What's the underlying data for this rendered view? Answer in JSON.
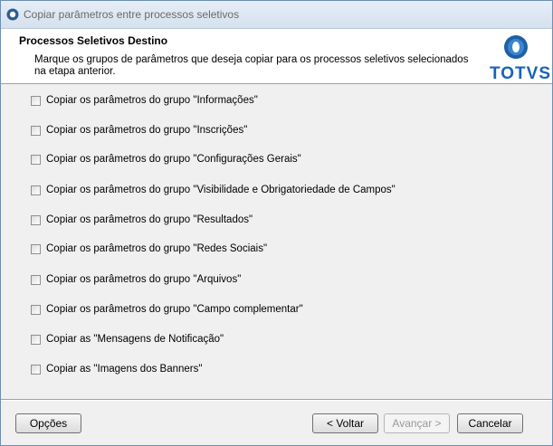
{
  "window": {
    "title": "Copiar parâmetros entre processos seletivos"
  },
  "header": {
    "title": "Processos Seletivos Destino",
    "description": "Marque os grupos de parâmetros que deseja copiar para os processos seletivos selecionados na etapa anterior.",
    "logo_text": "TOTVS",
    "logo_color": "#1b63b6"
  },
  "options": [
    {
      "label": "Copiar os parâmetros do grupo \"Informações\"",
      "checked": false
    },
    {
      "label": "Copiar os parâmetros do grupo \"Inscrições\"",
      "checked": false
    },
    {
      "label": "Copiar os parâmetros do grupo \"Configurações Gerais\"",
      "checked": false
    },
    {
      "label": "Copiar os parâmetros do grupo \"Visibilidade e Obrigatoriedade de Campos\"",
      "checked": false
    },
    {
      "label": "Copiar os parâmetros do grupo \"Resultados\"",
      "checked": false
    },
    {
      "label": "Copiar os parâmetros do grupo \"Redes Sociais\"",
      "checked": false
    },
    {
      "label": "Copiar os parâmetros do grupo \"Arquivos\"",
      "checked": false
    },
    {
      "label": "Copiar os parâmetros do grupo \"Campo complementar\"",
      "checked": false
    },
    {
      "label": "Copiar as \"Mensagens de Notificação\"",
      "checked": false
    },
    {
      "label": "Copiar as \"Imagens dos Banners\"",
      "checked": false
    }
  ],
  "buttons": {
    "options": "Opções",
    "back": "< Voltar",
    "next": "Avançar >",
    "cancel": "Cancelar"
  }
}
